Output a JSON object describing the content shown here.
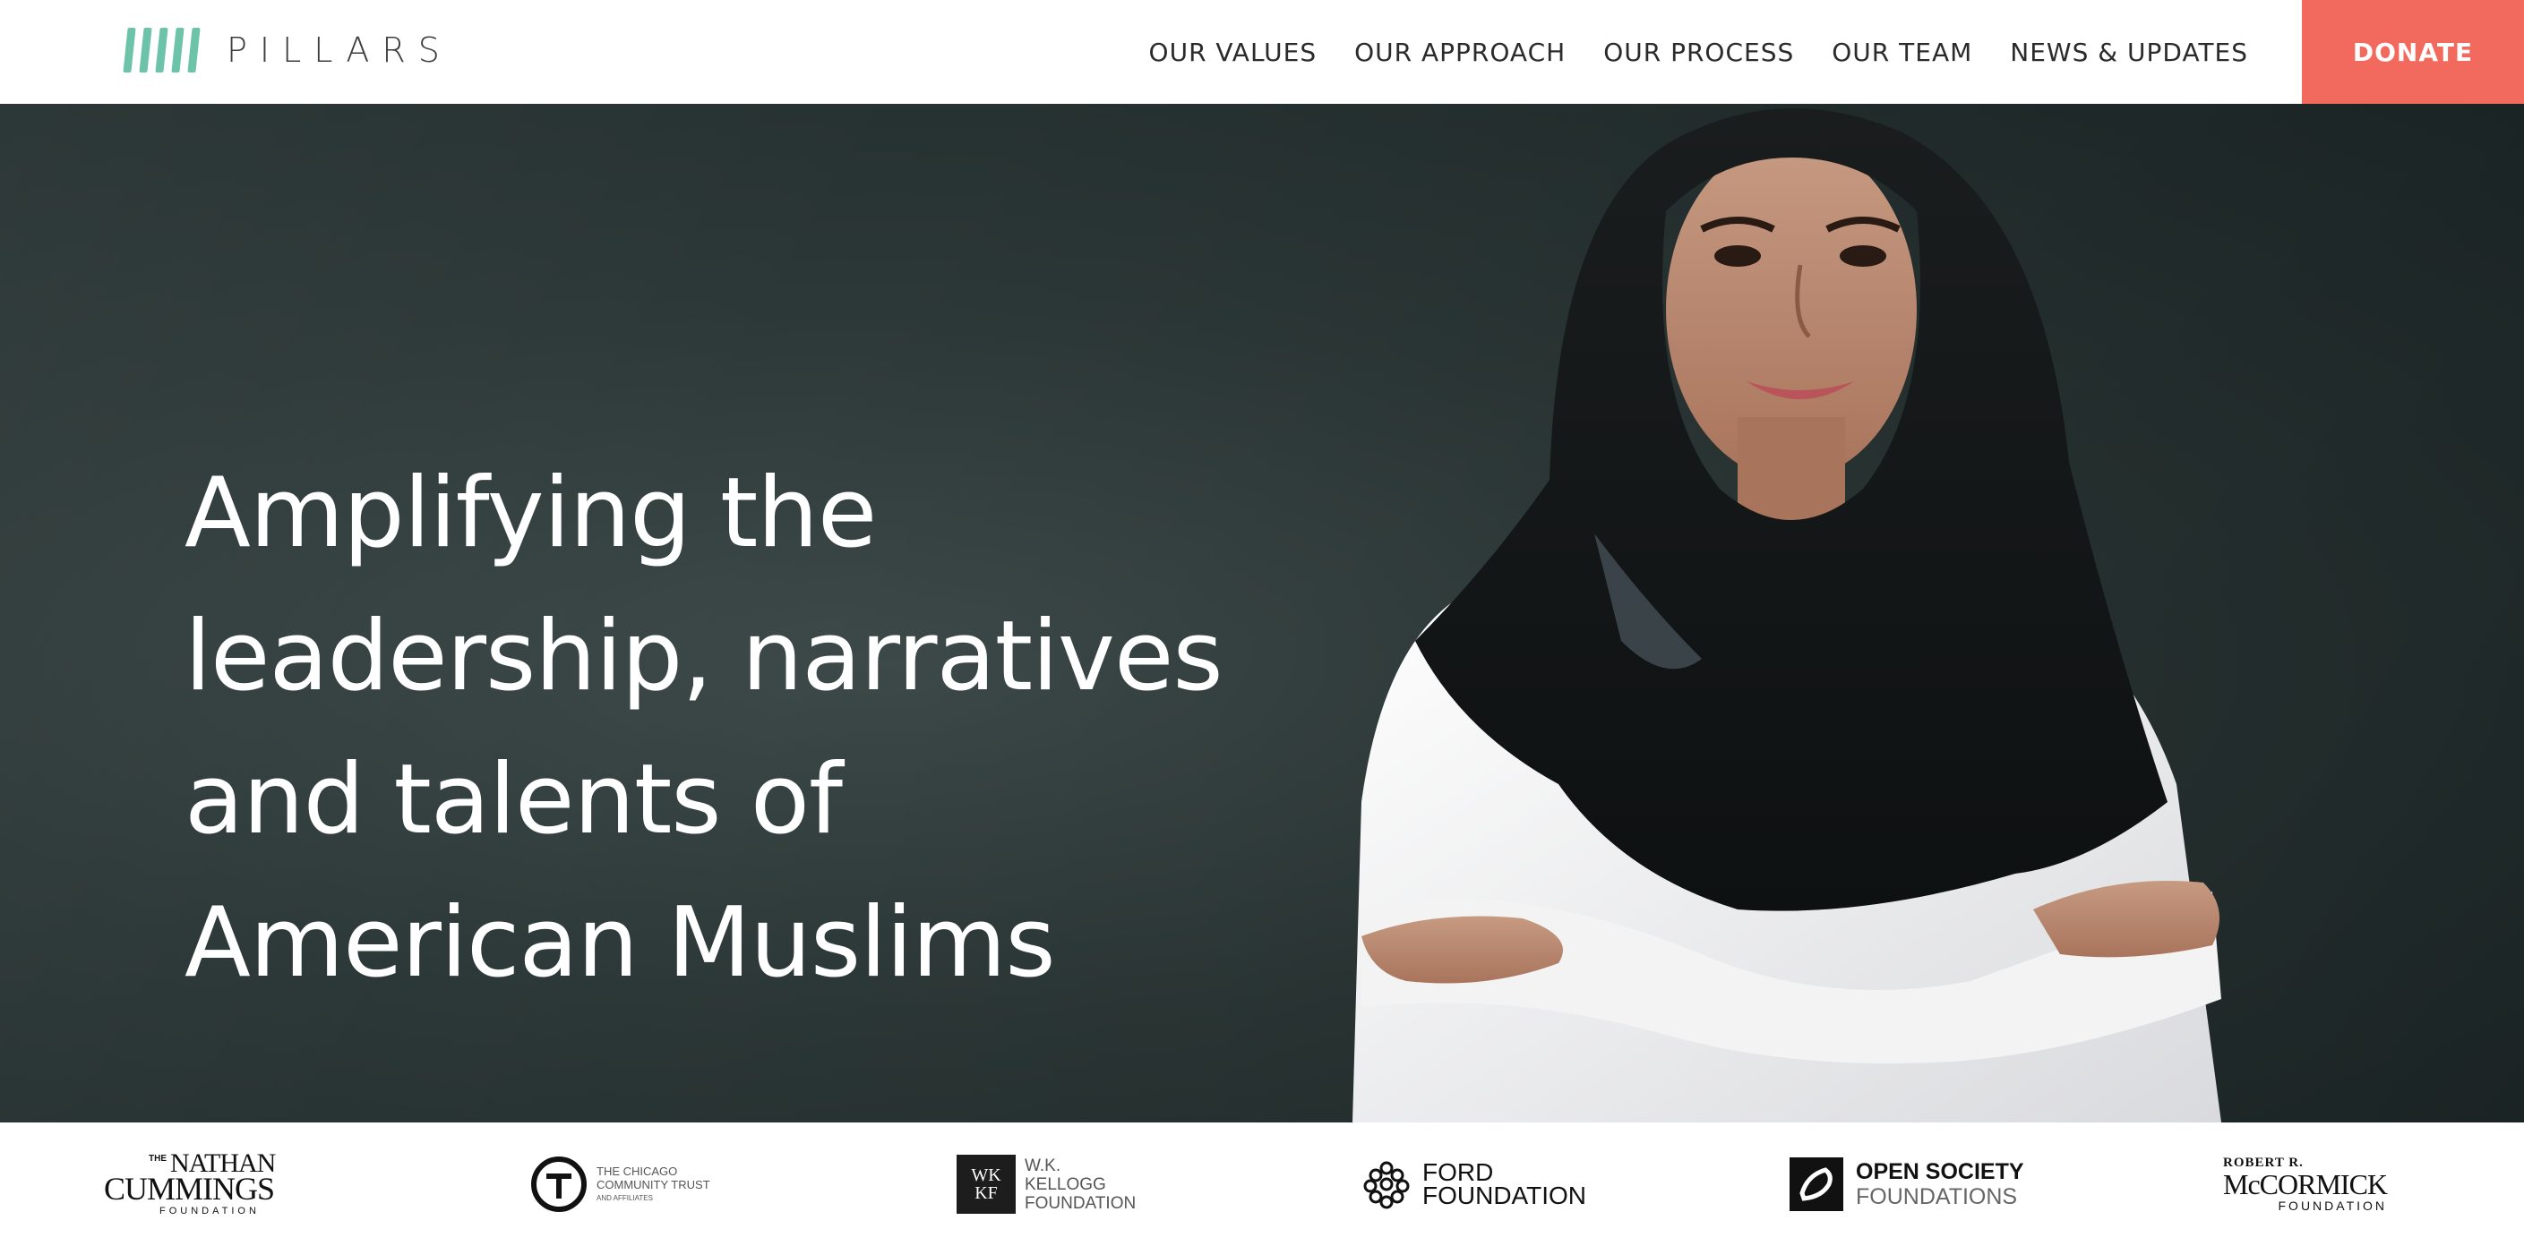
{
  "brand": {
    "name": "PILLARS",
    "accent": "#6cc3a8"
  },
  "nav": {
    "items": [
      {
        "label": "OUR VALUES"
      },
      {
        "label": "OUR APPROACH"
      },
      {
        "label": "OUR PROCESS"
      },
      {
        "label": "OUR TEAM"
      },
      {
        "label": "NEWS & UPDATES"
      }
    ],
    "donate_label": "DONATE",
    "donate_color": "#f26a5e"
  },
  "hero": {
    "lines": [
      "Amplifying the",
      "leadership, narratives",
      "and talents of",
      "American Muslims"
    ]
  },
  "funders": {
    "nathan": {
      "small": "THE",
      "line1": "NATHAN",
      "line2": "CUMMINGS",
      "line3": "FOUNDATION"
    },
    "chicago": {
      "line1": "THE CHICAGO",
      "line2": "COMMUNITY TRUST",
      "line3": "AND AFFILIATES"
    },
    "kellogg": {
      "mark": "WK KF",
      "line1": "W.K.",
      "line2": "KELLOGG",
      "line3": "FOUNDATION"
    },
    "ford": {
      "line1": "FORD",
      "line2": "FOUNDATION"
    },
    "opensociety": {
      "line1": "OPEN SOCIETY",
      "line2": "FOUNDATIONS"
    },
    "mccormick": {
      "line1": "ROBERT R.",
      "line2": "McCORMICK",
      "line3": "FOUNDATION"
    }
  }
}
